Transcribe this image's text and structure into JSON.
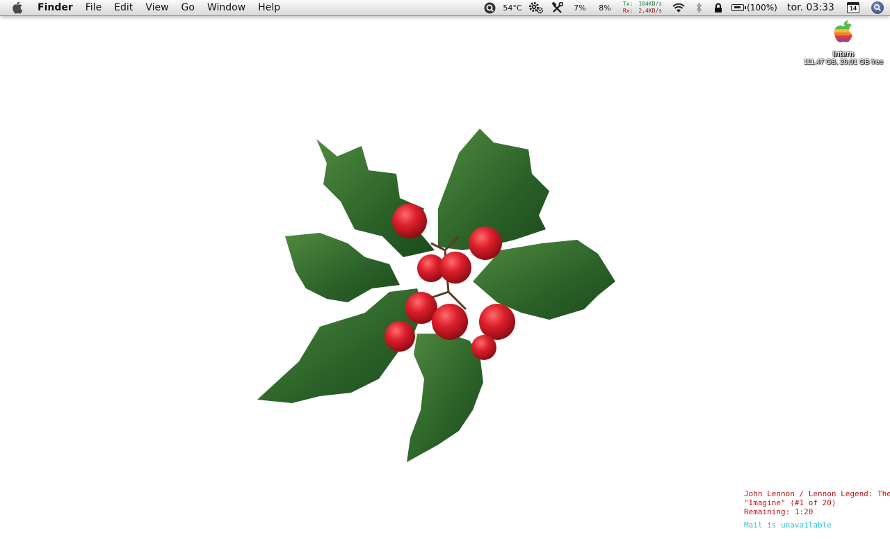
{
  "menubar": {
    "app_name": "Finder",
    "menus": [
      "File",
      "Edit",
      "View",
      "Go",
      "Window",
      "Help"
    ],
    "status": {
      "temperature": "54°C",
      "cpu1": "7%",
      "cpu2": "8%",
      "tx_label": "Tx:",
      "tx_value": "104KB/s",
      "rx_label": "Rx:",
      "rx_value": "2,4KB/s",
      "battery": "(100%)",
      "clock": "tor. 03:33",
      "calendar_day": "14"
    },
    "icons": [
      "apple-icon",
      "search-circle-icon",
      "gear-icon",
      "tools-icon",
      "wifi-icon",
      "bluetooth-icon",
      "lock-icon",
      "battery-icon",
      "calendar-icon",
      "spotlight-icon"
    ]
  },
  "desktop": {
    "drive": {
      "name": "Intern",
      "info": "111,47 GB, 20,01 GB free",
      "icon": "rainbow-apple-icon"
    },
    "now_playing": {
      "line1": "John Lennon / Lennon Legend: The Very Best of John Lennon",
      "line2": "\"Imagine\" (#1 of 20)",
      "line3": "Remaining: 1:20"
    },
    "mail_status": "Mail is unavailable"
  },
  "colors": {
    "tx": "#17803a",
    "rx": "#a11212",
    "now_playing": "#c0141b",
    "mail": "#27c3d8",
    "leaf": "#2f6a2c",
    "berry": "#d81f2a"
  }
}
